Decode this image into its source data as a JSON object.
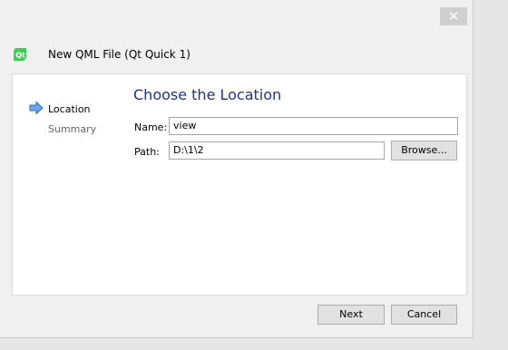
{
  "window": {
    "title": "New QML File (Qt Quick 1)",
    "close_label": "✕"
  },
  "sidebar": {
    "steps": [
      {
        "label": "Location",
        "active": true
      },
      {
        "label": "Summary",
        "active": false
      }
    ]
  },
  "main": {
    "heading": "Choose the Location",
    "name_label": "Name:",
    "name_value": "view",
    "path_label": "Path:",
    "path_value": "D:\\1\\2",
    "browse_label": "Browse..."
  },
  "footer": {
    "next_label": "Next",
    "cancel_label": "Cancel"
  },
  "colors": {
    "heading": "#1e3287",
    "step_arrow": "#3c8cd8",
    "qt_logo": "#41cd52"
  }
}
